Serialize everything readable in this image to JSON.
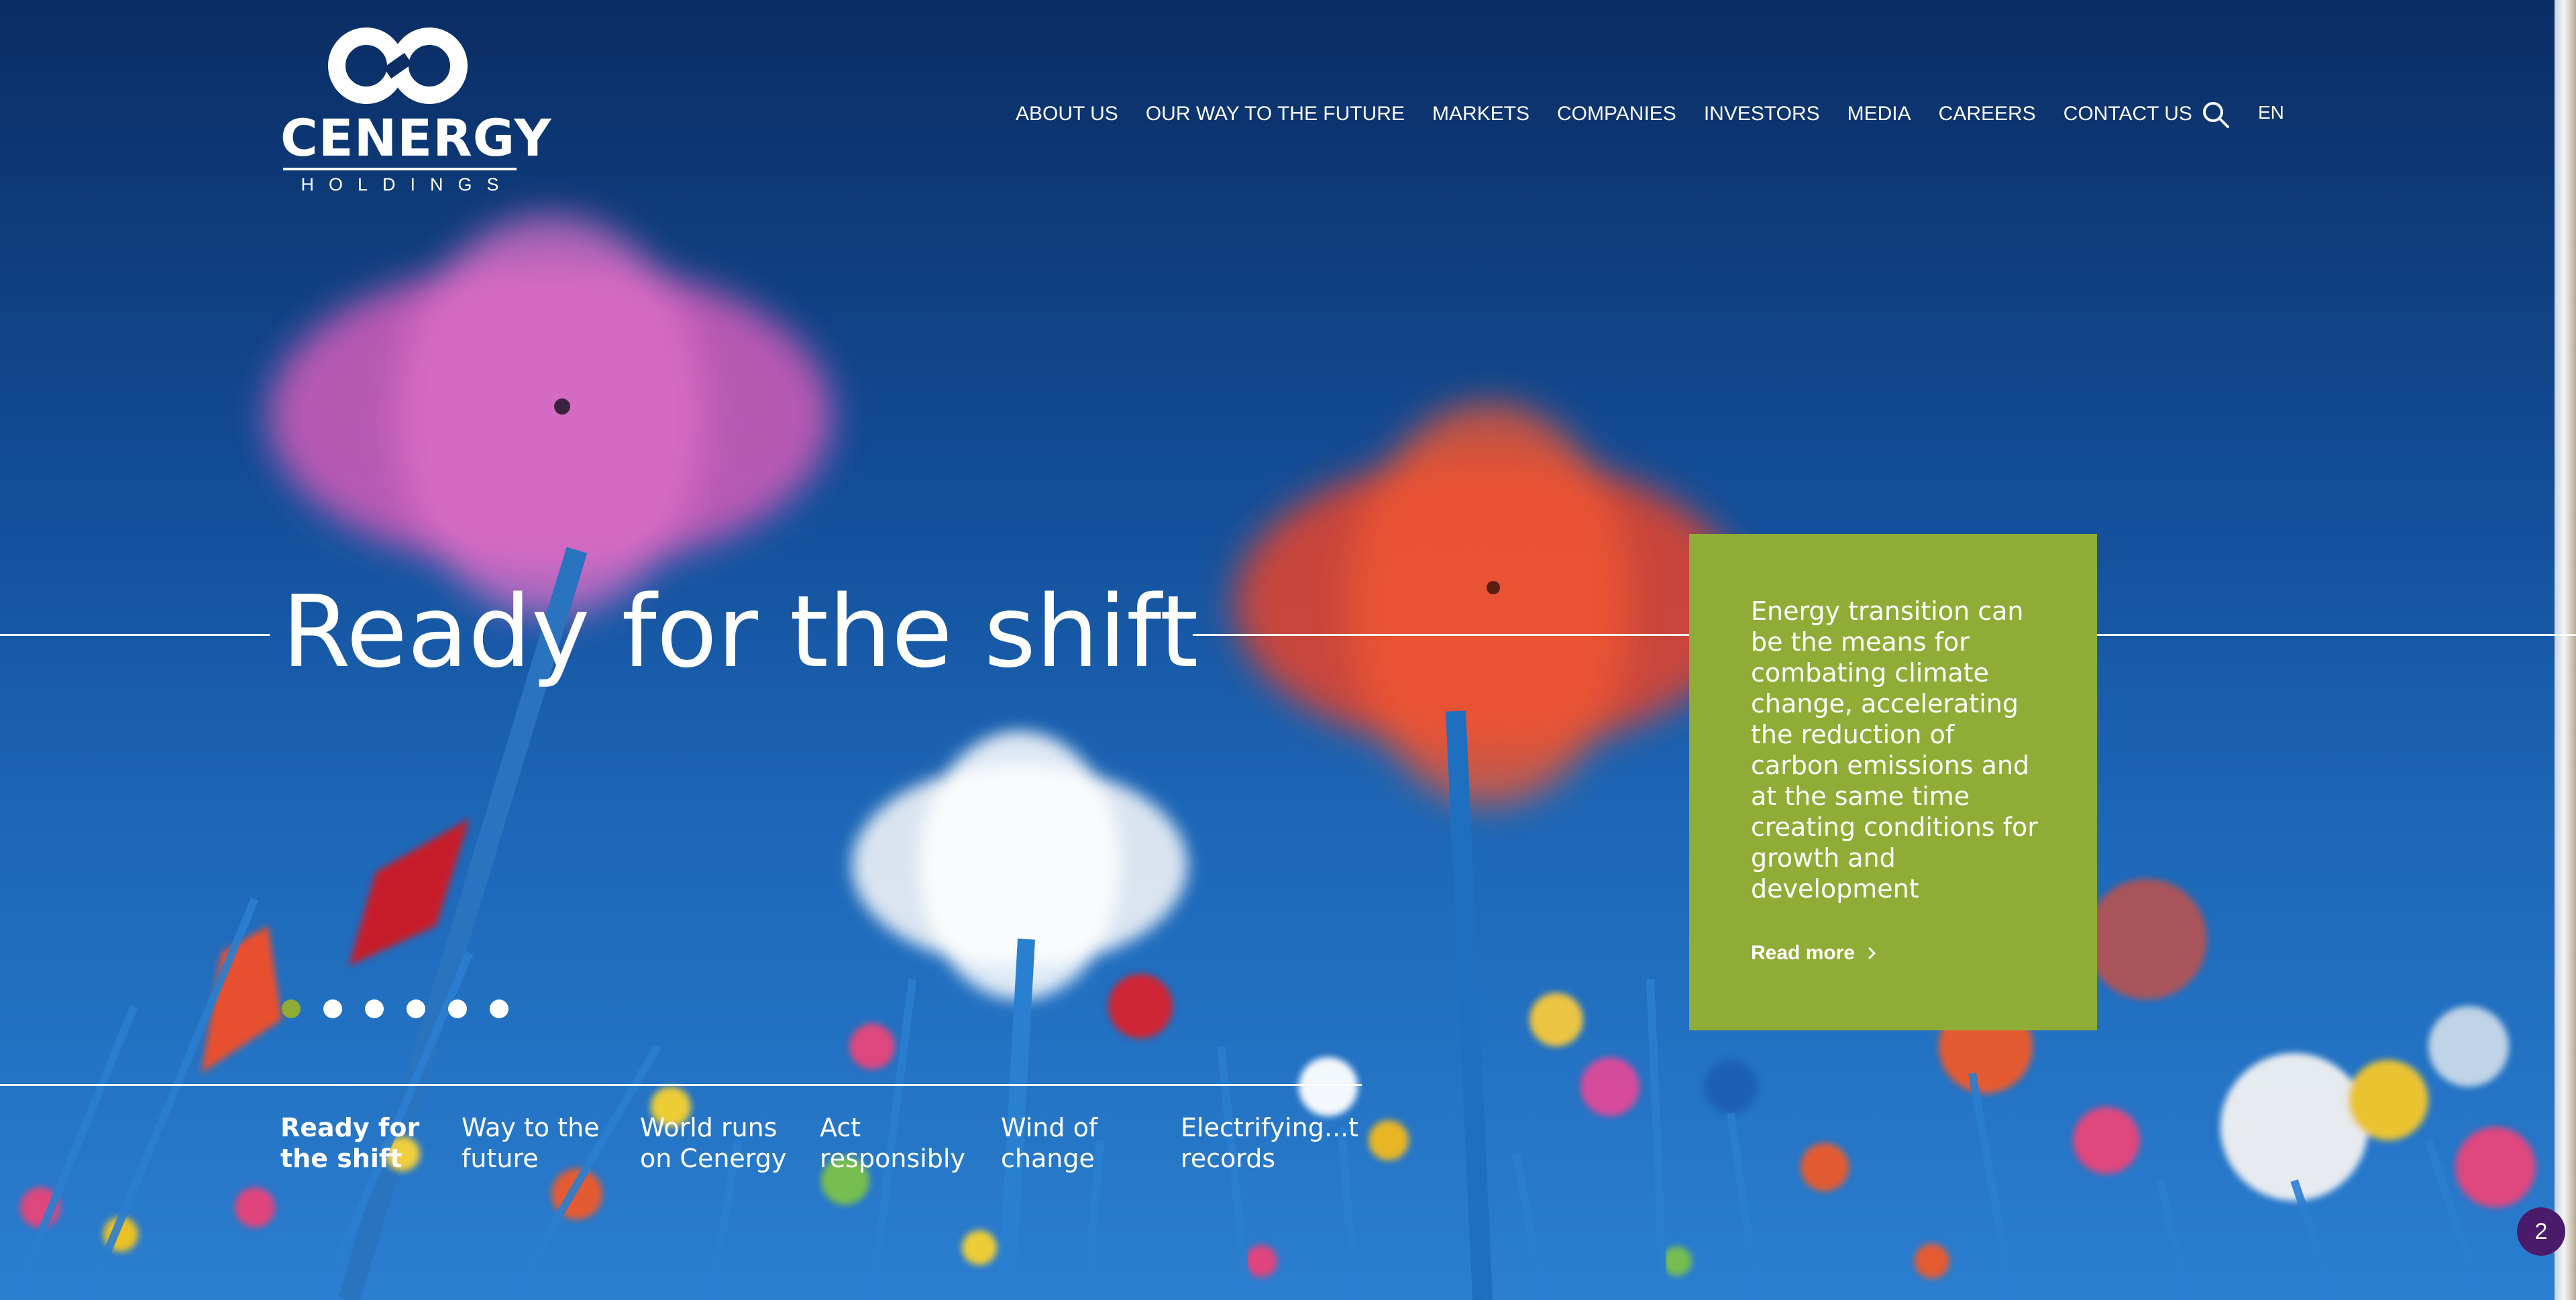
{
  "brand": {
    "name": "CENERGY",
    "subtitle": "HOLDINGS"
  },
  "nav": {
    "items": [
      {
        "label": "ABOUT US"
      },
      {
        "label": "OUR WAY TO THE FUTURE"
      },
      {
        "label": "MARKETS"
      },
      {
        "label": "COMPANIES"
      },
      {
        "label": "INVESTORS"
      },
      {
        "label": "MEDIA"
      },
      {
        "label": "CAREERS"
      },
      {
        "label": "CONTACT US"
      }
    ],
    "search_icon": "search-icon",
    "language": "EN"
  },
  "hero": {
    "title": "Ready for the shift",
    "card": {
      "text": "Energy transition can be the means for combating climate change, accelerating the reduction of carbon emissions and at the same time creating conditions for growth and development",
      "read_more": "Read more",
      "background_color": "#8fad36"
    }
  },
  "slider": {
    "dot_count": 6,
    "active_index": 0,
    "tabs": [
      {
        "label": "Ready for the shift",
        "active": true
      },
      {
        "label": "Way to the future",
        "active": false
      },
      {
        "label": "World runs on Cenergy",
        "active": false
      },
      {
        "label": "Act responsibly",
        "active": false
      },
      {
        "label": "Wind of change",
        "active": false
      },
      {
        "label": "Electrifying...t records",
        "active": false
      }
    ]
  },
  "chat_badge": {
    "count": "2",
    "color": "#4a1a6b"
  }
}
